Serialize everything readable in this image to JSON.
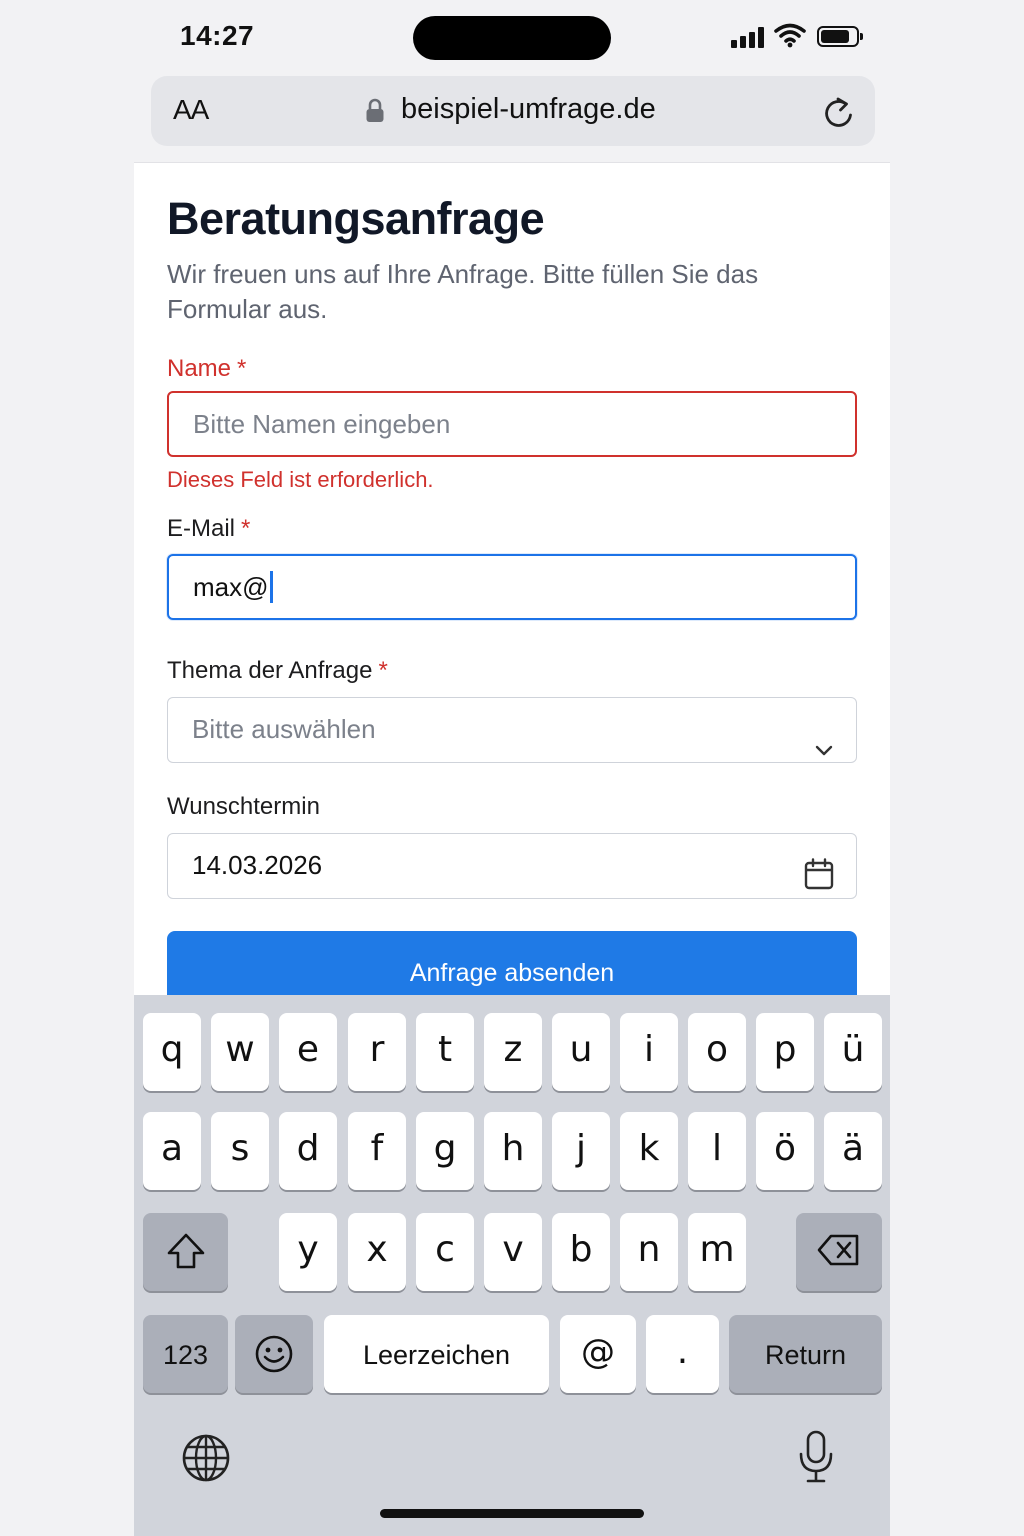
{
  "status_bar": {
    "time": "14:27"
  },
  "browser": {
    "text_size_button": "AA",
    "url": "beispiel-umfrage.de"
  },
  "form": {
    "title": "Beratungsanfrage",
    "subtitle": "Wir freuen uns auf Ihre Anfrage. Bitte füllen Sie das Formular aus.",
    "required_marker": "*",
    "name": {
      "label": "Name",
      "placeholder": "Bitte Namen eingeben",
      "value": "",
      "error": "Dieses Feld ist erforderlich."
    },
    "email": {
      "label": "E-Mail",
      "value": "max@"
    },
    "topic": {
      "label": "Thema der Anfrage",
      "selected": "Bitte auswählen"
    },
    "date": {
      "label": "Wunschtermin",
      "value": "14.03.2026"
    },
    "submit_label": "Anfrage absenden"
  },
  "keyboard": {
    "row1": [
      "q",
      "w",
      "e",
      "r",
      "t",
      "z",
      "u",
      "i",
      "o",
      "p",
      "ü"
    ],
    "row2": [
      "a",
      "s",
      "d",
      "f",
      "g",
      "h",
      "j",
      "k",
      "l",
      "ö",
      "ä"
    ],
    "row3": [
      "y",
      "x",
      "c",
      "v",
      "b",
      "n",
      "m"
    ],
    "numbers_label": "123",
    "space_label": "Leerzeichen",
    "at_label": "@",
    "dot_label": ".",
    "return_label": "Return"
  },
  "colors": {
    "accent": "#1f7ae6",
    "error": "#d0312d",
    "keyboard_bg": "#d1d4db"
  }
}
